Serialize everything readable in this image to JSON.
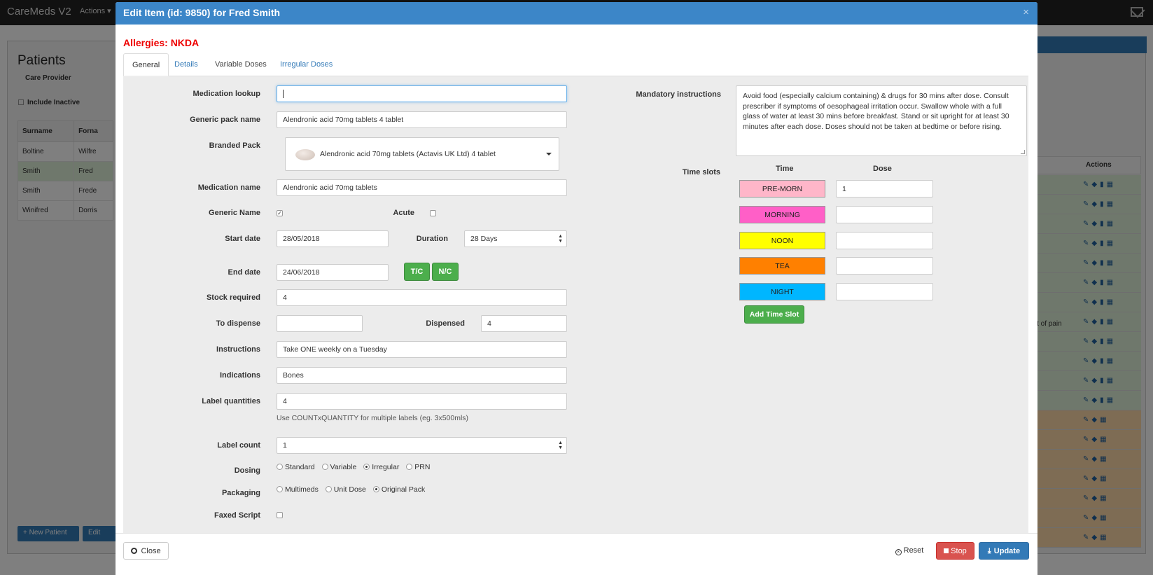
{
  "background": {
    "brand": "CareMeds V2",
    "nav_actions": "Actions ▾",
    "panel_title": "Patients",
    "care_provider": "Care Provider",
    "include_inactive": "Include Inactive",
    "table_headers": [
      "Surname",
      "Forna"
    ],
    "rows": [
      [
        "Boltine",
        "Wilfre"
      ],
      [
        "Smith",
        "Fred"
      ],
      [
        "Smith",
        "Frede"
      ],
      [
        "Winifred",
        "Dorris"
      ]
    ],
    "new_patient": "+ New Patient",
    "edit": "Edit",
    "actions_header": "Actions",
    "pain_text": "ent of pain"
  },
  "modal": {
    "title": "Edit Item (id: 9850) for Fred Smith",
    "close_symbol": "×",
    "allergies": "Allergies: NKDA",
    "tabs": [
      "General",
      "Details",
      "Variable Doses",
      "Irregular Doses"
    ]
  },
  "form": {
    "medication_lookup": {
      "label": "Medication lookup",
      "value": ""
    },
    "generic_pack_name": {
      "label": "Generic pack name",
      "value": "Alendronic acid 70mg tablets 4 tablet"
    },
    "branded_pack": {
      "label": "Branded Pack",
      "value": "Alendronic acid 70mg tablets (Actavis UK Ltd) 4 tablet"
    },
    "medication_name": {
      "label": "Medication name",
      "value": "Alendronic acid 70mg tablets"
    },
    "generic_name": {
      "label": "Generic Name",
      "checked": true
    },
    "acute": {
      "label": "Acute",
      "checked": false
    },
    "start_date": {
      "label": "Start date",
      "value": "28/05/2018"
    },
    "duration": {
      "label": "Duration",
      "value": "28 Days"
    },
    "end_date": {
      "label": "End date",
      "value": "24/06/2018"
    },
    "tc_button": "T/C",
    "nc_button": "N/C",
    "stock_required": {
      "label": "Stock required",
      "value": "4"
    },
    "to_dispense": {
      "label": "To dispense",
      "value": ""
    },
    "dispensed": {
      "label": "Dispensed",
      "value": "4"
    },
    "instructions": {
      "label": "Instructions",
      "value": "Take ONE weekly on a Tuesday"
    },
    "indications": {
      "label": "Indications",
      "value": "Bones"
    },
    "label_quantities": {
      "label": "Label quantities",
      "value": "4",
      "hint": "Use COUNTxQUANTITY for multiple labels (eg. 3x500mls)"
    },
    "label_count": {
      "label": "Label count",
      "value": "1"
    },
    "dosing": {
      "label": "Dosing",
      "options": [
        "Standard",
        "Variable",
        "Irregular",
        "PRN"
      ],
      "selected": "Irregular"
    },
    "packaging": {
      "label": "Packaging",
      "options": [
        "Multimeds",
        "Unit Dose",
        "Original Pack"
      ],
      "selected": "Original Pack"
    },
    "faxed_script": {
      "label": "Faxed Script",
      "checked": false
    },
    "mandatory_instructions": {
      "label": "Mandatory instructions",
      "value": "Avoid food (especially calcium containing) & drugs for 30 mins after dose. Consult prescriber if symptoms of oesophageal irritation occur. Swallow whole with a full glass of water at least 30 mins before breakfast. Stand or sit upright for at least 30 minutes after each dose. Doses should not be taken at bedtime or before rising."
    },
    "time_slots": {
      "label": "Time slots",
      "col_time": "Time",
      "col_dose": "Dose",
      "slots": [
        {
          "name": "PRE-MORN",
          "color": "#ffb6c9",
          "dose": "1"
        },
        {
          "name": "MORNING",
          "color": "#ff5fc7",
          "dose": ""
        },
        {
          "name": "NOON",
          "color": "#ffff00",
          "dose": ""
        },
        {
          "name": "TEA",
          "color": "#ff8000",
          "dose": ""
        },
        {
          "name": "NIGHT",
          "color": "#00b6ff",
          "dose": ""
        }
      ],
      "add_button": "Add Time Slot"
    }
  },
  "footer": {
    "close": "Close",
    "reset": "Reset",
    "stop": "Stop",
    "update": "Update"
  }
}
